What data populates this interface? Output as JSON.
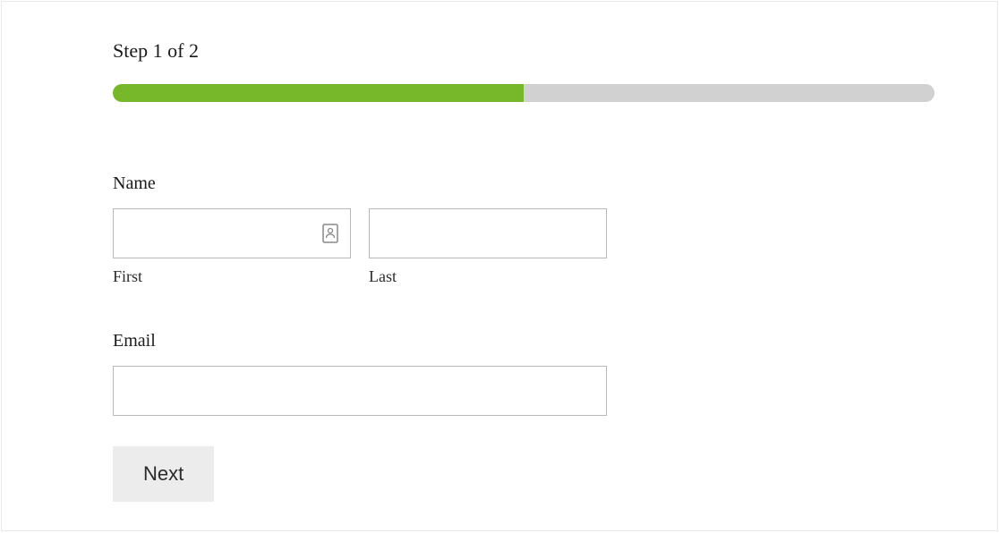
{
  "step": {
    "label": "Step 1 of 2",
    "current": 1,
    "total": 2,
    "progressPercent": 50
  },
  "form": {
    "name": {
      "label": "Name",
      "first": {
        "value": "",
        "subLabel": "First"
      },
      "last": {
        "value": "",
        "subLabel": "Last"
      }
    },
    "email": {
      "label": "Email",
      "value": ""
    },
    "nextButton": {
      "label": "Next"
    }
  },
  "colors": {
    "progressFill": "#76b82a",
    "progressTrack": "#d1d1d1",
    "buttonBg": "#ececec",
    "border": "#b8b8b8"
  }
}
